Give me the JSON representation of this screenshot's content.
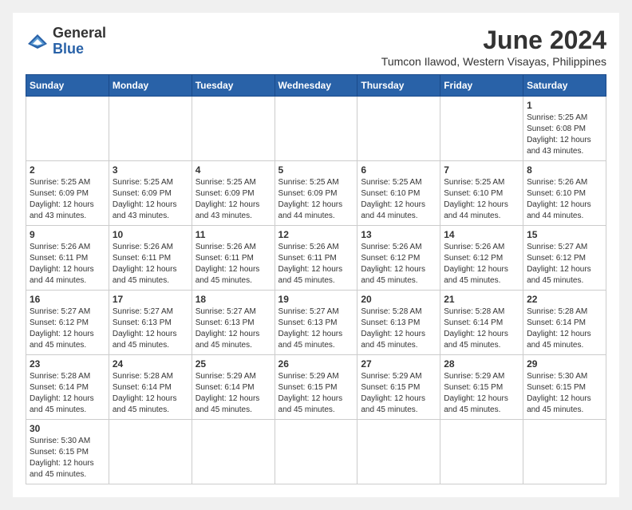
{
  "header": {
    "logo_general": "General",
    "logo_blue": "Blue",
    "month_title": "June 2024",
    "subtitle": "Tumcon Ilawod, Western Visayas, Philippines"
  },
  "days_of_week": [
    "Sunday",
    "Monday",
    "Tuesday",
    "Wednesday",
    "Thursday",
    "Friday",
    "Saturday"
  ],
  "weeks": [
    [
      {
        "day": "",
        "info": ""
      },
      {
        "day": "",
        "info": ""
      },
      {
        "day": "",
        "info": ""
      },
      {
        "day": "",
        "info": ""
      },
      {
        "day": "",
        "info": ""
      },
      {
        "day": "",
        "info": ""
      },
      {
        "day": "1",
        "info": "Sunrise: 5:25 AM\nSunset: 6:08 PM\nDaylight: 12 hours and 43 minutes."
      }
    ],
    [
      {
        "day": "2",
        "info": "Sunrise: 5:25 AM\nSunset: 6:09 PM\nDaylight: 12 hours and 43 minutes."
      },
      {
        "day": "3",
        "info": "Sunrise: 5:25 AM\nSunset: 6:09 PM\nDaylight: 12 hours and 43 minutes."
      },
      {
        "day": "4",
        "info": "Sunrise: 5:25 AM\nSunset: 6:09 PM\nDaylight: 12 hours and 43 minutes."
      },
      {
        "day": "5",
        "info": "Sunrise: 5:25 AM\nSunset: 6:09 PM\nDaylight: 12 hours and 44 minutes."
      },
      {
        "day": "6",
        "info": "Sunrise: 5:25 AM\nSunset: 6:10 PM\nDaylight: 12 hours and 44 minutes."
      },
      {
        "day": "7",
        "info": "Sunrise: 5:25 AM\nSunset: 6:10 PM\nDaylight: 12 hours and 44 minutes."
      },
      {
        "day": "8",
        "info": "Sunrise: 5:26 AM\nSunset: 6:10 PM\nDaylight: 12 hours and 44 minutes."
      }
    ],
    [
      {
        "day": "9",
        "info": "Sunrise: 5:26 AM\nSunset: 6:11 PM\nDaylight: 12 hours and 44 minutes."
      },
      {
        "day": "10",
        "info": "Sunrise: 5:26 AM\nSunset: 6:11 PM\nDaylight: 12 hours and 45 minutes."
      },
      {
        "day": "11",
        "info": "Sunrise: 5:26 AM\nSunset: 6:11 PM\nDaylight: 12 hours and 45 minutes."
      },
      {
        "day": "12",
        "info": "Sunrise: 5:26 AM\nSunset: 6:11 PM\nDaylight: 12 hours and 45 minutes."
      },
      {
        "day": "13",
        "info": "Sunrise: 5:26 AM\nSunset: 6:12 PM\nDaylight: 12 hours and 45 minutes."
      },
      {
        "day": "14",
        "info": "Sunrise: 5:26 AM\nSunset: 6:12 PM\nDaylight: 12 hours and 45 minutes."
      },
      {
        "day": "15",
        "info": "Sunrise: 5:27 AM\nSunset: 6:12 PM\nDaylight: 12 hours and 45 minutes."
      }
    ],
    [
      {
        "day": "16",
        "info": "Sunrise: 5:27 AM\nSunset: 6:12 PM\nDaylight: 12 hours and 45 minutes."
      },
      {
        "day": "17",
        "info": "Sunrise: 5:27 AM\nSunset: 6:13 PM\nDaylight: 12 hours and 45 minutes."
      },
      {
        "day": "18",
        "info": "Sunrise: 5:27 AM\nSunset: 6:13 PM\nDaylight: 12 hours and 45 minutes."
      },
      {
        "day": "19",
        "info": "Sunrise: 5:27 AM\nSunset: 6:13 PM\nDaylight: 12 hours and 45 minutes."
      },
      {
        "day": "20",
        "info": "Sunrise: 5:28 AM\nSunset: 6:13 PM\nDaylight: 12 hours and 45 minutes."
      },
      {
        "day": "21",
        "info": "Sunrise: 5:28 AM\nSunset: 6:14 PM\nDaylight: 12 hours and 45 minutes."
      },
      {
        "day": "22",
        "info": "Sunrise: 5:28 AM\nSunset: 6:14 PM\nDaylight: 12 hours and 45 minutes."
      }
    ],
    [
      {
        "day": "23",
        "info": "Sunrise: 5:28 AM\nSunset: 6:14 PM\nDaylight: 12 hours and 45 minutes."
      },
      {
        "day": "24",
        "info": "Sunrise: 5:28 AM\nSunset: 6:14 PM\nDaylight: 12 hours and 45 minutes."
      },
      {
        "day": "25",
        "info": "Sunrise: 5:29 AM\nSunset: 6:14 PM\nDaylight: 12 hours and 45 minutes."
      },
      {
        "day": "26",
        "info": "Sunrise: 5:29 AM\nSunset: 6:15 PM\nDaylight: 12 hours and 45 minutes."
      },
      {
        "day": "27",
        "info": "Sunrise: 5:29 AM\nSunset: 6:15 PM\nDaylight: 12 hours and 45 minutes."
      },
      {
        "day": "28",
        "info": "Sunrise: 5:29 AM\nSunset: 6:15 PM\nDaylight: 12 hours and 45 minutes."
      },
      {
        "day": "29",
        "info": "Sunrise: 5:30 AM\nSunset: 6:15 PM\nDaylight: 12 hours and 45 minutes."
      }
    ],
    [
      {
        "day": "30",
        "info": "Sunrise: 5:30 AM\nSunset: 6:15 PM\nDaylight: 12 hours and 45 minutes."
      },
      {
        "day": "",
        "info": ""
      },
      {
        "day": "",
        "info": ""
      },
      {
        "day": "",
        "info": ""
      },
      {
        "day": "",
        "info": ""
      },
      {
        "day": "",
        "info": ""
      },
      {
        "day": "",
        "info": ""
      }
    ]
  ]
}
